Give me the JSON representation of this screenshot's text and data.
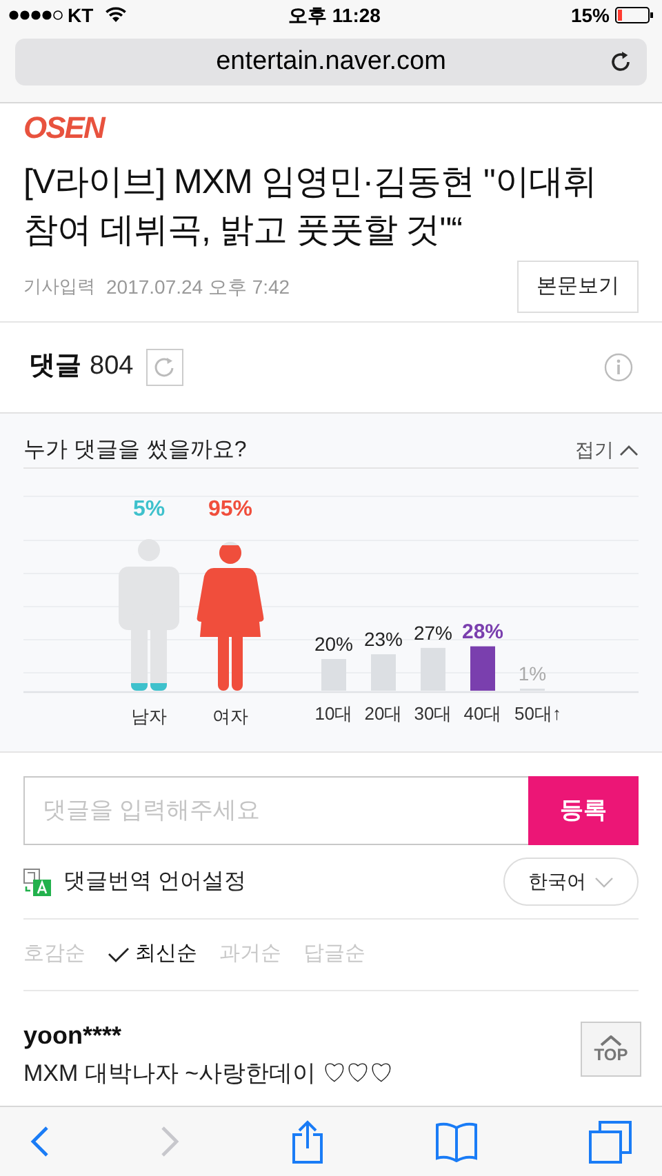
{
  "status_bar": {
    "carrier": "KT",
    "time": "오후 11:28",
    "battery": "15%"
  },
  "browser": {
    "url": "entertain.naver.com"
  },
  "article": {
    "source_logo": "OSEN",
    "title": "[V라이브] MXM 임영민·김동현 \"이대휘 참여 데뷔곡, 밝고 풋풋할 것\"“",
    "date_label": "기사입력",
    "date": "2017.07.24 오후 7:42",
    "view_button": "본문보기"
  },
  "comments": {
    "label": "댓글",
    "count": "804"
  },
  "stats": {
    "title": "누가 댓글을 썼을까요?",
    "collapse": "접기",
    "expanded": true,
    "gender": [
      {
        "label": "남자",
        "percent": "5%",
        "color": "#3ec1cc"
      },
      {
        "label": "여자",
        "percent": "95%",
        "color": "#f04e3c"
      }
    ],
    "age_groups": [
      {
        "label": "10대",
        "percent": "20%",
        "selected": false
      },
      {
        "label": "20대",
        "percent": "23%",
        "selected": false
      },
      {
        "label": "30대",
        "percent": "27%",
        "selected": false
      },
      {
        "label": "40대",
        "percent": "28%",
        "selected": true
      },
      {
        "label": "50대↑",
        "percent": "1%",
        "selected": false
      }
    ]
  },
  "comment_form": {
    "placeholder": "댓글을 입력해주세요",
    "submit": "등록"
  },
  "translation": {
    "label": "댓글번역 언어설정",
    "language": "한국어"
  },
  "sort_options": [
    {
      "label": "호감순",
      "selected": false
    },
    {
      "label": "최신순",
      "selected": true
    },
    {
      "label": "과거순",
      "selected": false
    },
    {
      "label": "답글순",
      "selected": false
    }
  ],
  "comment_list": [
    {
      "user": "yoon****",
      "text": "MXM 대박나자 ~사랑한데이 ♡♡♡"
    }
  ],
  "top_button": "TOP",
  "toolbar": {
    "back_enabled": true,
    "forward_enabled": false
  }
}
